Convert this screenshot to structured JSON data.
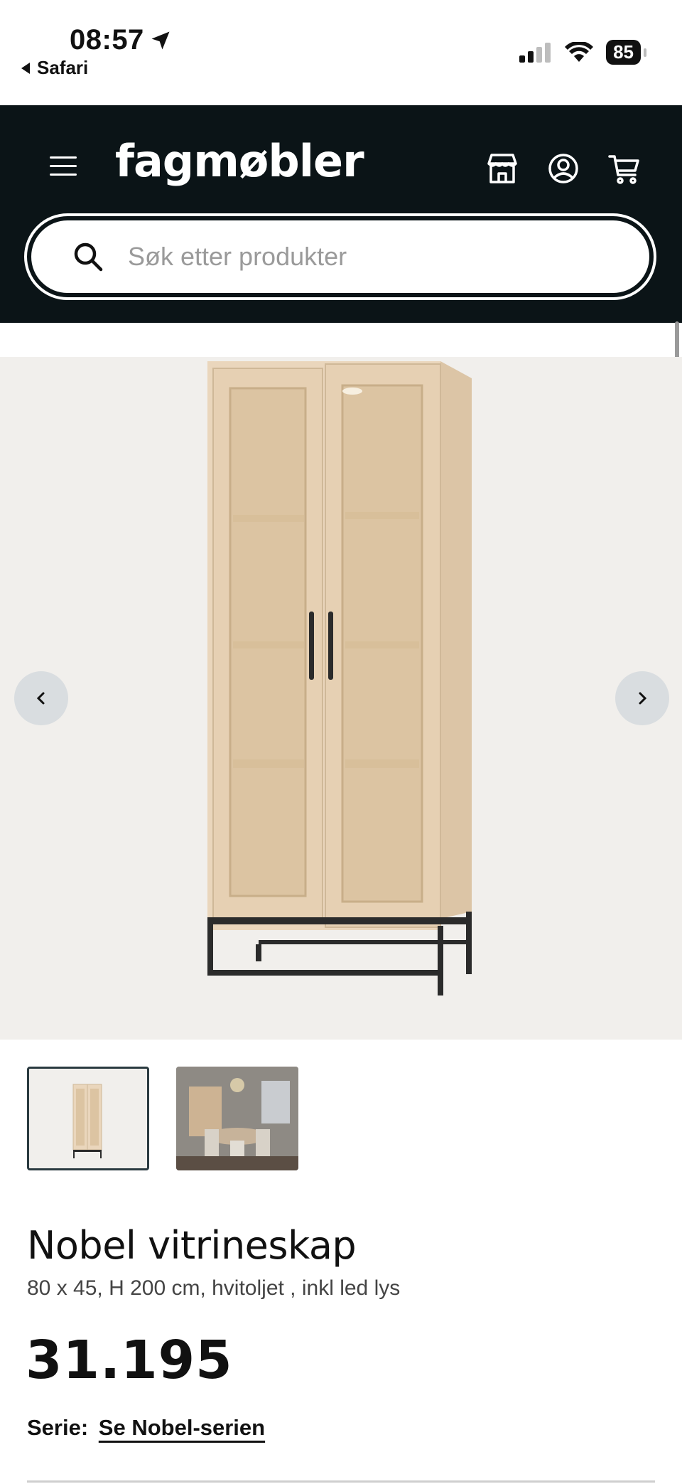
{
  "status_bar": {
    "time": "08:57",
    "back_app": "Safari",
    "battery": "85"
  },
  "header": {
    "logo": "fagmøbler",
    "search": {
      "placeholder": "Søk etter produkter",
      "value": ""
    }
  },
  "product": {
    "title": "Nobel vitrineskap",
    "subtitle": "80 x 45, H 200 cm, hvitoljet , inkl led lys",
    "price": "31.195",
    "series_label": "Serie:",
    "series_link": "Se Nobel-serien"
  },
  "colors": {
    "header_bg": "#0b1417",
    "gallery_bg": "#f1efec",
    "wood": "#e8d3b8",
    "metal": "#2b2b2b"
  },
  "icons": [
    "hamburger-icon",
    "store-icon",
    "account-icon",
    "cart-icon",
    "search-icon",
    "chevron-left-icon",
    "chevron-right-icon",
    "location-arrow-icon",
    "signal-icon",
    "wifi-icon"
  ]
}
